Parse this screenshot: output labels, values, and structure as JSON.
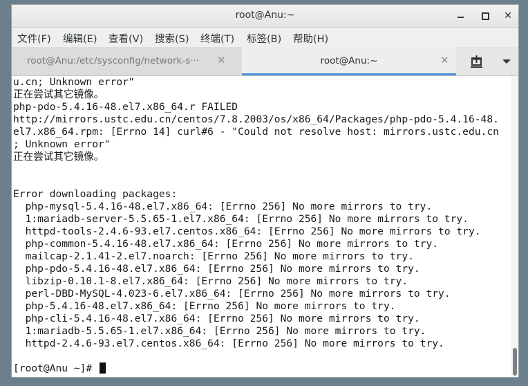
{
  "window": {
    "title": "root@Anu:~",
    "minimize": "minimize",
    "maximize": "maximize",
    "close": "✕"
  },
  "menu": [
    "文件(F)",
    "编辑(E)",
    "查看(V)",
    "搜索(S)",
    "终端(T)",
    "标签(B)",
    "帮助(H)"
  ],
  "tabs": [
    {
      "label": "root@Anu:/etc/sysconfig/network-s···",
      "active": false
    },
    {
      "label": "root@Anu:~",
      "active": true
    }
  ],
  "tab_close_glyph": "✕",
  "terminal": {
    "lines": [
      "u.cn; Unknown error\"",
      "正在尝试其它镜像。",
      "php-pdo-5.4.16-48.el7.x86_64.r FAILED",
      "http://mirrors.ustc.edu.cn/centos/7.8.2003/os/x86_64/Packages/php-pdo-5.4.16-48.",
      "el7.x86_64.rpm: [Errno 14] curl#6 - \"Could not resolve host: mirrors.ustc.edu.cn",
      "; Unknown error\"",
      "正在尝试其它镜像。",
      "",
      "",
      "Error downloading packages:",
      "  php-mysql-5.4.16-48.el7.x86_64: [Errno 256] No more mirrors to try.",
      "  1:mariadb-server-5.5.65-1.el7.x86_64: [Errno 256] No more mirrors to try.",
      "  httpd-tools-2.4.6-93.el7.centos.x86_64: [Errno 256] No more mirrors to try.",
      "  php-common-5.4.16-48.el7.x86_64: [Errno 256] No more mirrors to try.",
      "  mailcap-2.1.41-2.el7.noarch: [Errno 256] No more mirrors to try.",
      "  php-pdo-5.4.16-48.el7.x86_64: [Errno 256] No more mirrors to try.",
      "  libzip-0.10.1-8.el7.x86_64: [Errno 256] No more mirrors to try.",
      "  perl-DBD-MySQL-4.023-6.el7.x86_64: [Errno 256] No more mirrors to try.",
      "  php-5.4.16-48.el7.x86_64: [Errno 256] No more mirrors to try.",
      "  php-cli-5.4.16-48.el7.x86_64: [Errno 256] No more mirrors to try.",
      "  1:mariadb-5.5.65-1.el7.x86_64: [Errno 256] No more mirrors to try.",
      "  httpd-2.4.6-93.el7.centos.x86_64: [Errno 256] No more mirrors to try.",
      "",
      ""
    ],
    "prompt": "[root@Anu ~]# "
  },
  "icons": {
    "new_tab": "new-tab-icon",
    "menu": "chevron-down-icon"
  },
  "colors": {
    "active_tab_indicator": "#4a90d9",
    "terminal_bg": "#ffffff",
    "terminal_fg": "#1a1a1a"
  }
}
